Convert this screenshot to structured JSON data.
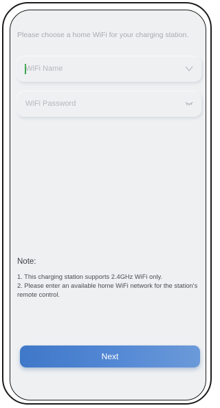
{
  "instruction": "Please choose a home WiFi for your charging station.",
  "wifi_name": {
    "placeholder": "WiFi Name",
    "icon": "chevron-down-icon"
  },
  "wifi_password": {
    "placeholder": "WiFi Password",
    "icon": "eye-closed-icon"
  },
  "note": {
    "title": "Note:",
    "line1": "1. This charging station supports 2.4GHz WiFi only.",
    "line2": "2. Please enter an available home WiFi network for the station's remote control."
  },
  "next_button": {
    "label": "Next"
  },
  "colors": {
    "screen_background": "#eef0f2",
    "button_start": "#3f78c8",
    "button_end": "#6b9ad9",
    "cursor": "#3aa84a"
  }
}
